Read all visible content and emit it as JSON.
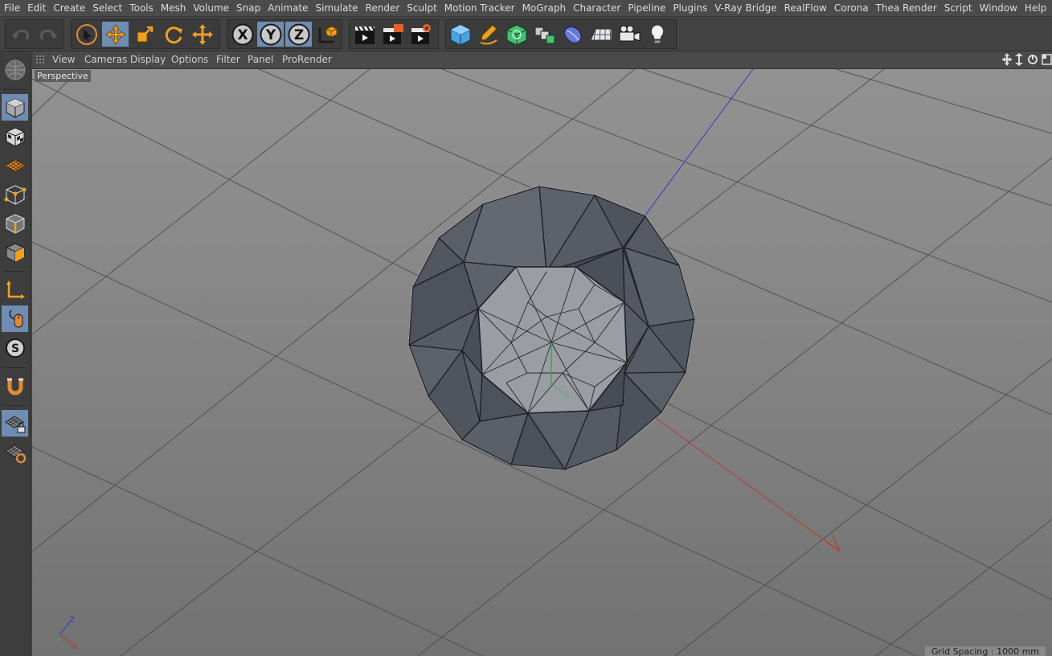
{
  "menu": [
    "File",
    "Edit",
    "Create",
    "Select",
    "Tools",
    "Mesh",
    "Volume",
    "Snap",
    "Animate",
    "Simulate",
    "Render",
    "Sculpt",
    "Motion Tracker",
    "MoGraph",
    "Character",
    "Pipeline",
    "Plugins",
    "V-Ray Bridge",
    "RealFlow",
    "Corona",
    "Thea Render",
    "Script",
    "Window",
    "Help"
  ],
  "toolbar": {
    "undo": "undo-icon",
    "redo": "redo-icon",
    "tools": [
      "live-selection-icon",
      "move-icon",
      "scale-icon",
      "rotate-icon",
      "recent-tool-icon"
    ],
    "active_tool": "move-icon",
    "axis_x": "X",
    "axis_y": "Y",
    "axis_z": "Z",
    "coordinate_system": "world-coordinates-icon",
    "render": [
      "render-view-icon",
      "render-to-picture-viewer-icon",
      "render-settings-icon"
    ],
    "objects": [
      "cube-icon",
      "pen-icon",
      "subdivision-surface-icon",
      "array-icon",
      "deformer-icon",
      "floor-icon",
      "camera-icon",
      "light-icon"
    ]
  },
  "left_palette": {
    "items": [
      "make-editable-icon",
      "model-mode-icon",
      "texture-mode-icon",
      "workplane-icon",
      "points-mode-icon",
      "edges-mode-icon",
      "polygons-mode-icon",
      "axis-mode-icon",
      "tweak-mode-icon",
      "solo-icon",
      "snapping-icon",
      "locked-workplane-icon",
      "planar-workplane-icon"
    ],
    "active": [
      "model-mode-icon",
      "tweak-mode-icon",
      "locked-workplane-icon"
    ]
  },
  "viewport_menu": [
    "View",
    "Cameras",
    "Display",
    "Options",
    "Filter",
    "Panel",
    "ProRender"
  ],
  "viewport": {
    "camera_label": "Perspective",
    "grid_spacing": "Grid Spacing : 1000 mm",
    "axis_labels": {
      "x": "X",
      "y": "Y",
      "z": "Z"
    },
    "colors": {
      "x_axis": "#c0392b",
      "y_axis": "#27ae60",
      "z_axis": "#2c3ec9",
      "object_dark": "#5b6068",
      "object_light": "#9a9ea3",
      "active": "#6f8cb3"
    }
  }
}
